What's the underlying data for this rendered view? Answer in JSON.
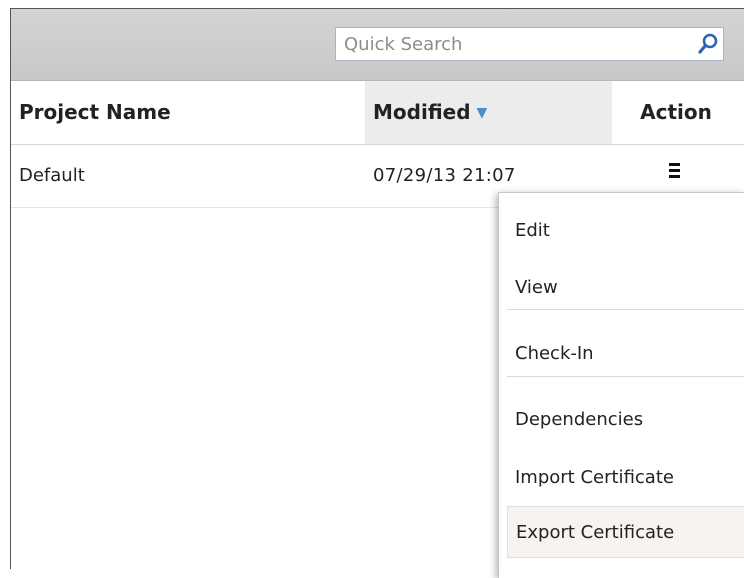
{
  "search": {
    "placeholder": "Quick Search"
  },
  "table": {
    "columns": {
      "project_name": "Project Name",
      "modified": "Modified",
      "action": "Action"
    },
    "sort_indicator": "▼",
    "rows": [
      {
        "project_name": "Default",
        "modified": "07/29/13 21:07"
      }
    ]
  },
  "context_menu": {
    "items": [
      "Edit",
      "View",
      "Check-In",
      "Dependencies",
      "Import Certificate",
      "Export Certificate"
    ],
    "hovered_item": "Export Certificate"
  },
  "icons": {
    "search": "search-icon",
    "row_action": "hamburger-menu-icon",
    "sort": "sort-descending-icon"
  },
  "colors": {
    "toolbar": "#cccccc",
    "accent": "#4d8ad1",
    "search_icon": "#2a64b5"
  }
}
